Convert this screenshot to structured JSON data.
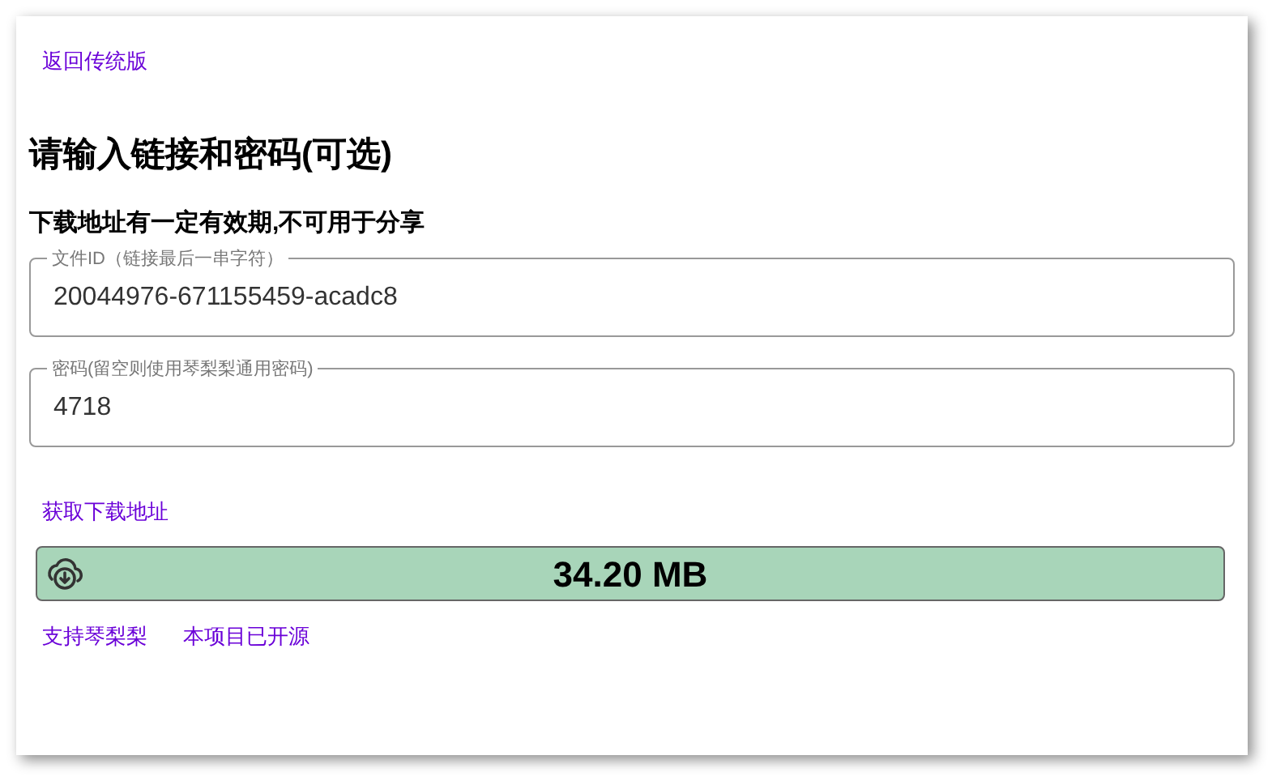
{
  "back_link": "返回传统版",
  "title": "请输入链接和密码(可选)",
  "subtitle": "下载地址有一定有效期,不可用于分享",
  "fields": [
    {
      "label": "文件ID（链接最后一串字符）",
      "value": "20044976-671155459-acadc8"
    },
    {
      "label": "密码(留空则使用琴梨梨通用密码)",
      "value": "4718"
    }
  ],
  "get_link": "获取下载地址",
  "download": {
    "size": "34.20 MB"
  },
  "footer_links": [
    "支持琴梨梨",
    "本项目已开源"
  ]
}
